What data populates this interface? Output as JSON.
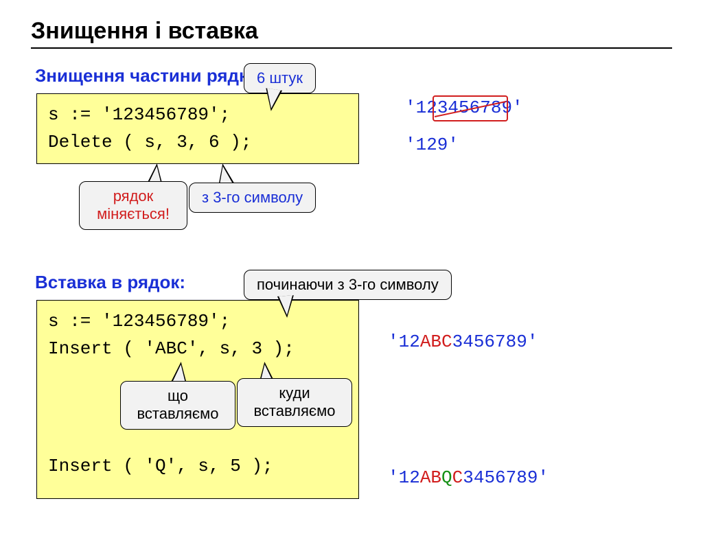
{
  "title": "Знищення і вставка",
  "s1": {
    "label": "Знищення частини рядка:",
    "code_line1": "s := '123456789';",
    "code_line2": "Delete ( s, 3, 6 );",
    "callout_count": "6 штук",
    "callout_pos": "з 3-го символу",
    "callout_row": "рядок міняється!",
    "out1_before_strike": "'12",
    "out1_strike": "345678",
    "out1_after_strike": "9'",
    "out2": "'129'"
  },
  "s2": {
    "label": "Вставка в рядок:",
    "code_line1": "s := '123456789';",
    "code_line2": "Insert ( 'ABC', s, 3 );",
    "code_line3": "Insert ( 'Q', s, 5 );",
    "callout_pos": "починаючи з 3-го символу",
    "callout_what": "що вставляємо",
    "callout_where": "куди вставляємо",
    "out1_a": "'12",
    "out1_b": "ABC",
    "out1_c": "3456789'",
    "out2_a": "'12",
    "out2_b": "AB",
    "out2_c": "Q",
    "out2_d": "C",
    "out2_e": "3456789'"
  }
}
